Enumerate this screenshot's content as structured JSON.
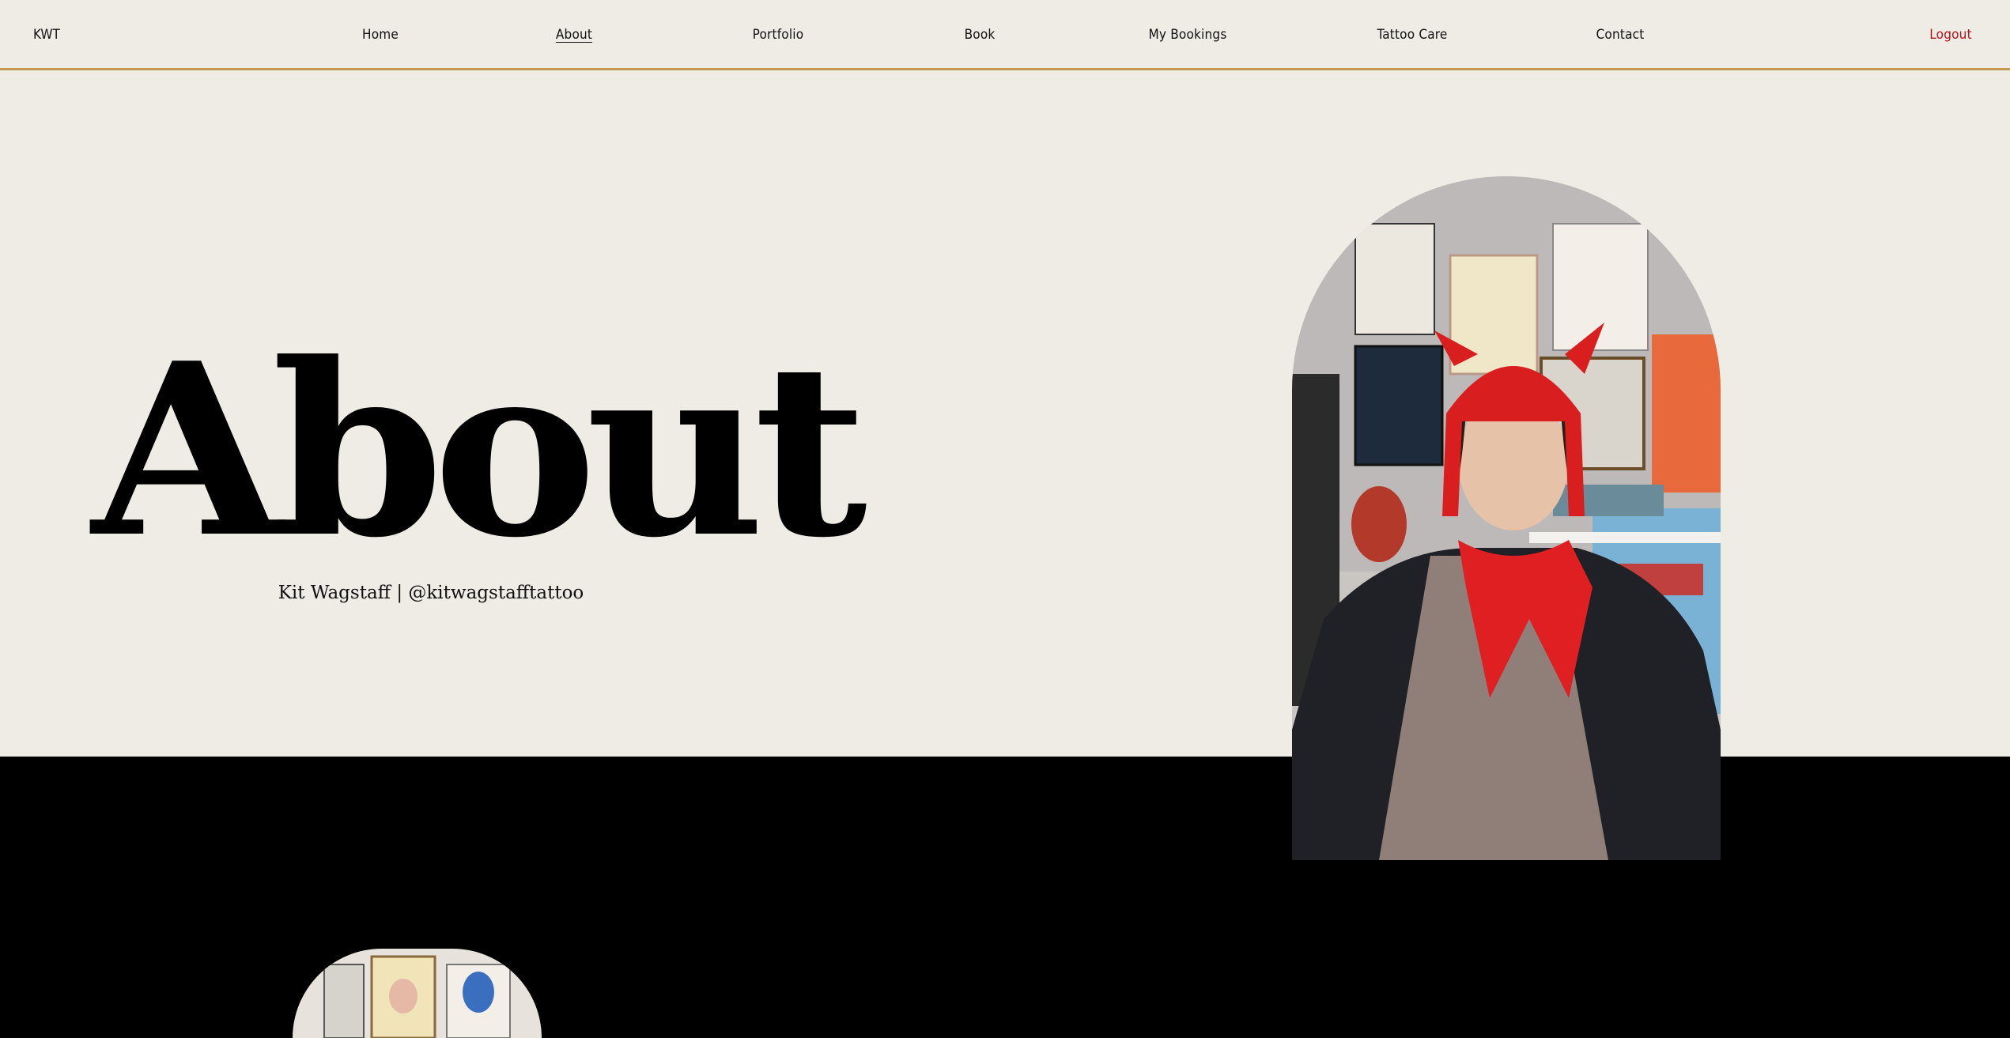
{
  "nav": {
    "brand": "KWT",
    "items": [
      {
        "label": "Home"
      },
      {
        "label": "About"
      },
      {
        "label": "Portfolio"
      },
      {
        "label": "Book"
      },
      {
        "label": "My Bookings"
      },
      {
        "label": "Tattoo Care"
      },
      {
        "label": "Contact"
      }
    ],
    "logout": "Logout"
  },
  "hero": {
    "title": "About",
    "subtitle": "Kit Wagstaff | @kitwagstafftattoo"
  },
  "colors": {
    "background": "#efebe5",
    "accent_border": "#c49a52",
    "logout": "#b3141b",
    "dark_section": "#000000"
  }
}
